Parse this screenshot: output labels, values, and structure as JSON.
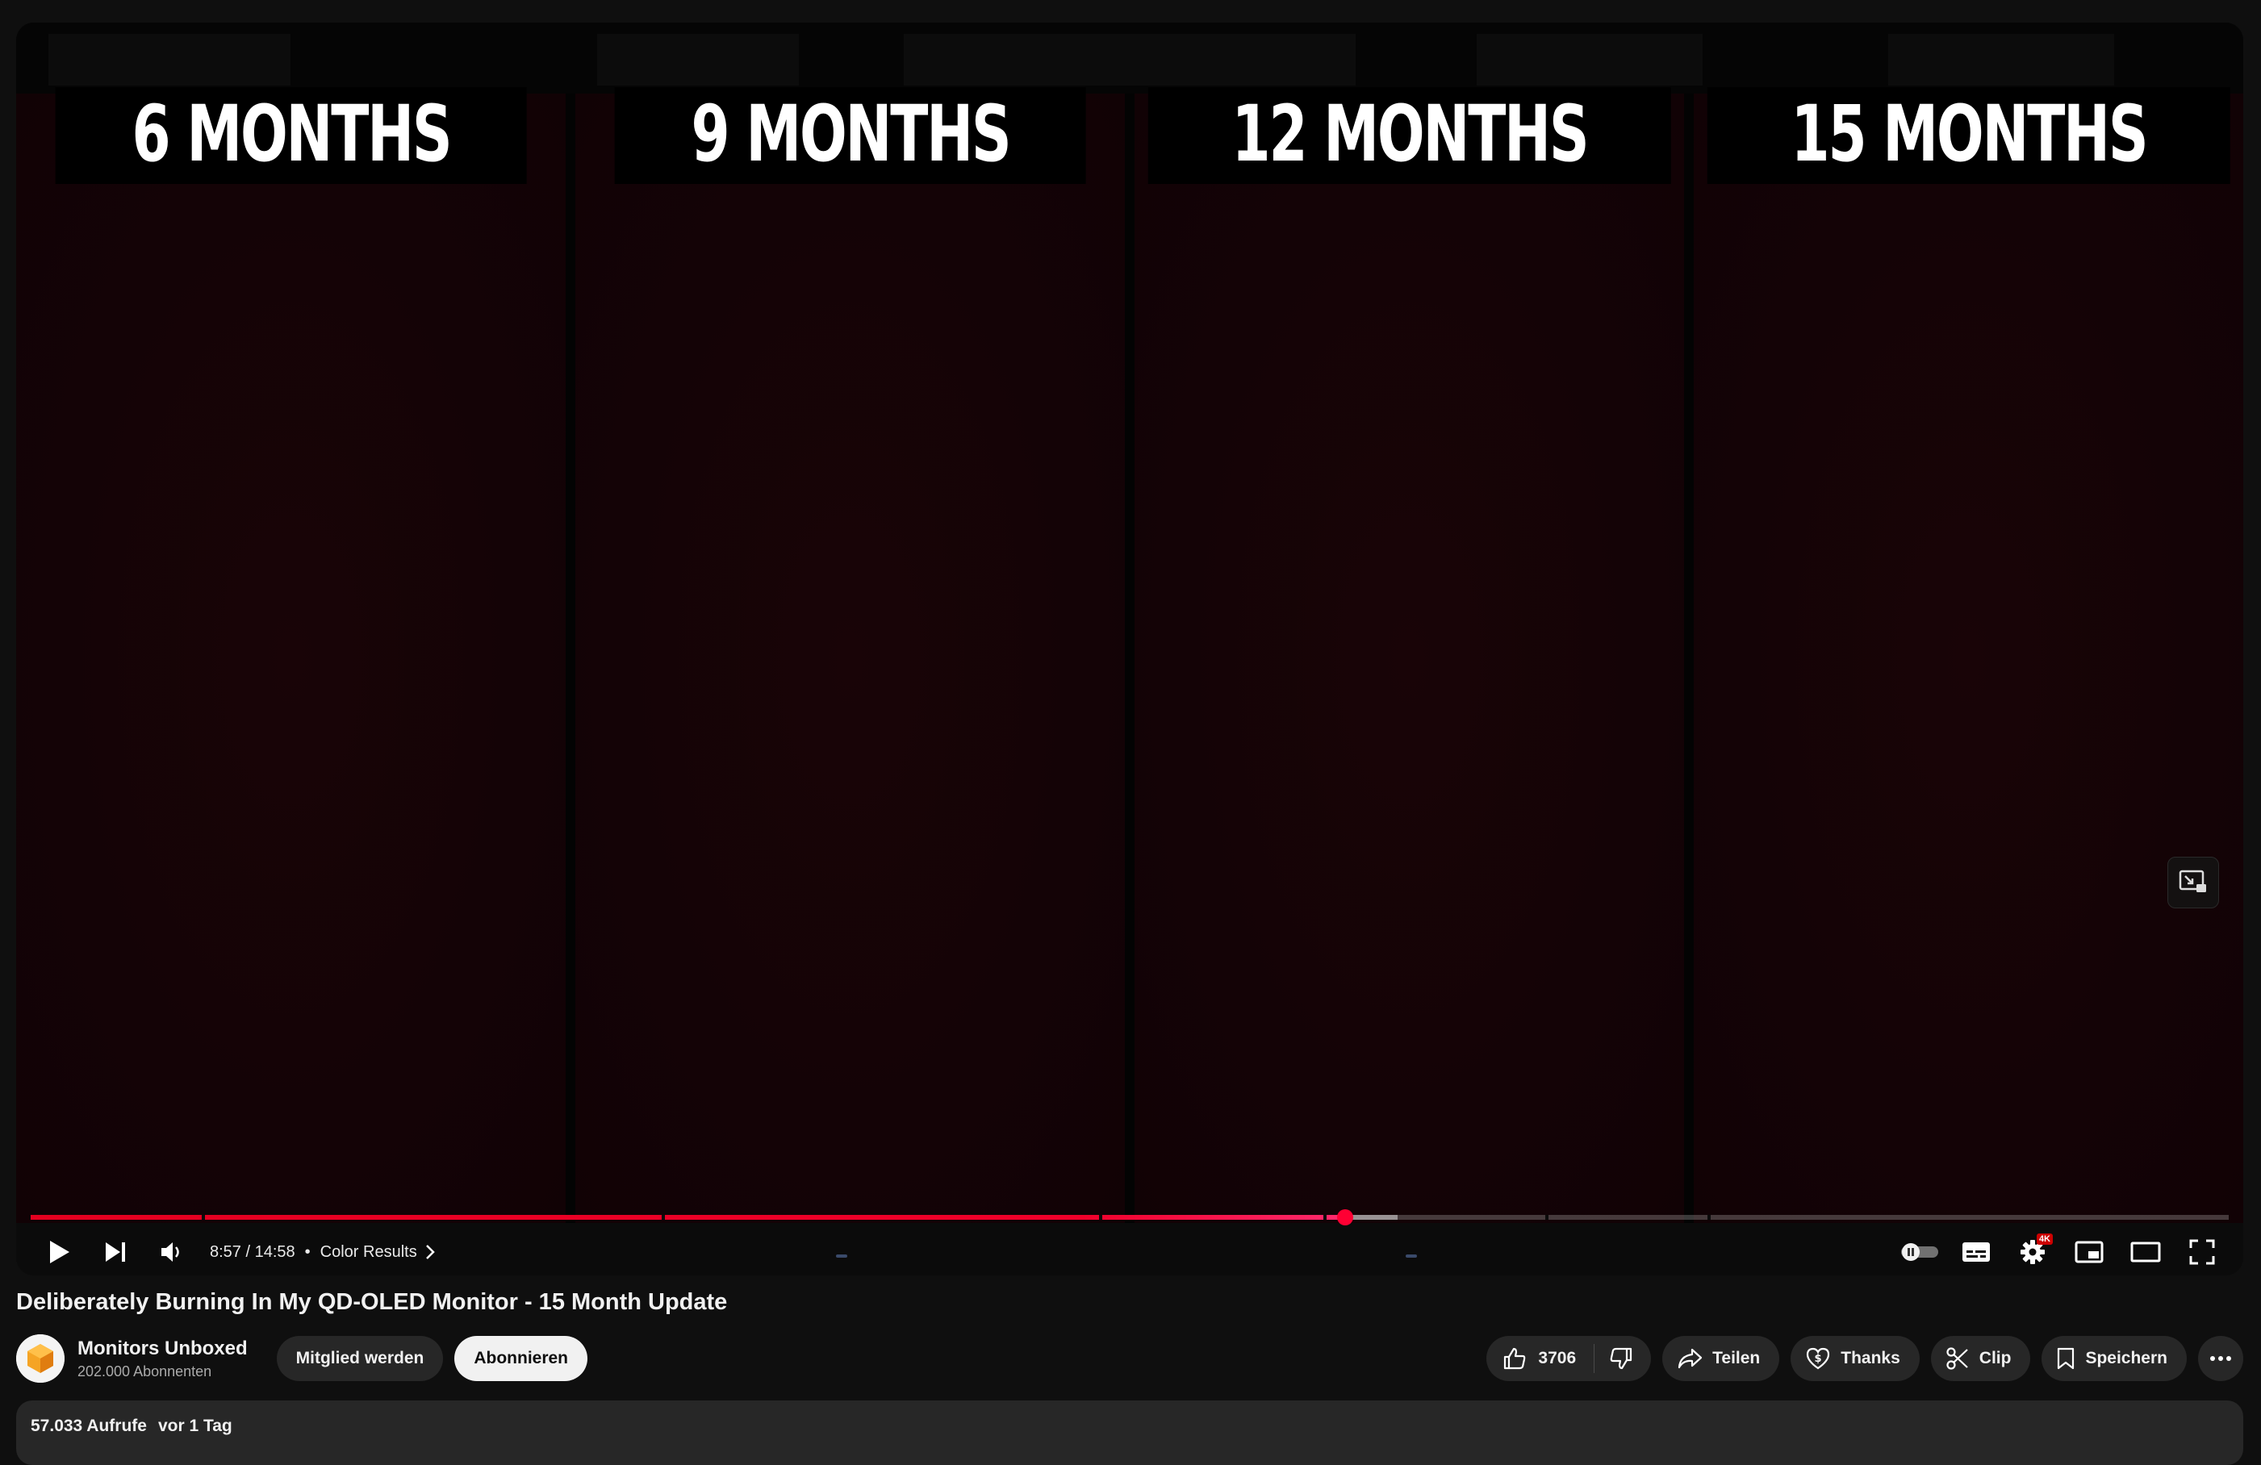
{
  "player": {
    "panels": [
      {
        "label": "6 MONTHS"
      },
      {
        "label": "9 MONTHS"
      },
      {
        "label": "12 MONTHS"
      },
      {
        "label": "15 MONTHS"
      }
    ],
    "progress": {
      "played_fraction": 0.598,
      "buffered_fraction": 0.622,
      "chapter_breaks": [
        0.078,
        0.287,
        0.486,
        0.588,
        0.689,
        0.763
      ]
    },
    "time_display": "8:57 / 14:58",
    "separator": "•",
    "chapter_title": "Color Results",
    "quality_badge": "4K",
    "icons": {
      "play": "play-icon",
      "next": "next-icon",
      "volume": "volume-icon",
      "chapter_arrow": "chevron-right-icon",
      "autoplay": "autoplay-toggle-icon",
      "subtitles": "subtitles-icon",
      "settings": "gear-icon",
      "miniplayer": "miniplayer-icon",
      "theater": "theater-mode-icon",
      "fullscreen": "fullscreen-icon",
      "overlay": "picture-in-picture-icon"
    },
    "accent_color": "#ff0033"
  },
  "video": {
    "title": "Deliberately Burning In My QD-OLED Monitor - 15 Month Update"
  },
  "channel": {
    "name": "Monitors Unboxed",
    "subscribers": "202.000 Abonnenten",
    "join_label": "Mitglied werden",
    "subscribe_label": "Abonnieren"
  },
  "actions": {
    "like_count": "3706",
    "share_label": "Teilen",
    "thanks_label": "Thanks",
    "clip_label": "Clip",
    "save_label": "Speichern"
  },
  "description": {
    "views": "57.033 Aufrufe",
    "date": "vor 1 Tag"
  }
}
